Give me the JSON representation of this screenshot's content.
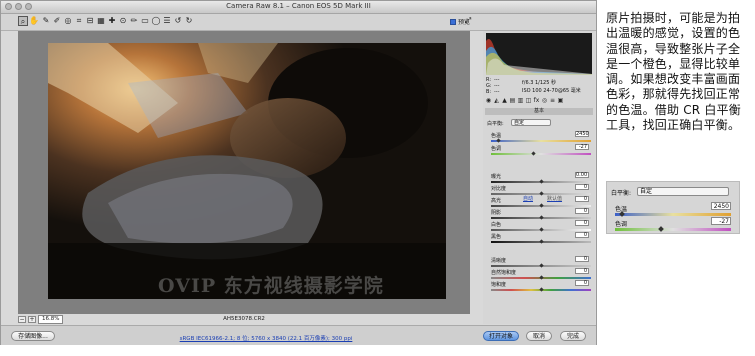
{
  "window": {
    "title": "Camera Raw 8.1 – Canon EOS 5D Mark III",
    "preview_label": "预览",
    "filename": "AH5E3078.CR2",
    "zoom": "16.8%",
    "watermark": "OVIP 东方视线摄影学院"
  },
  "histogram": {
    "aperture_shutter": "f/6.3  1/125 秒",
    "iso_lens": "ISO 100  24-70@65 毫米",
    "rgb_labels": [
      "R:",
      "G:",
      "B:"
    ],
    "rgb_values": [
      "---",
      "---",
      "---"
    ]
  },
  "panel": {
    "section": "基本",
    "white_balance_label": "白平衡:",
    "white_balance_value": "自定",
    "temperature_label": "色温",
    "temperature_value": "2450",
    "tint_label": "色调",
    "tint_value": "-27",
    "tab_auto": "自动",
    "tab_default": "默认值",
    "sliders": [
      {
        "label": "曝光",
        "value": "0.00"
      },
      {
        "label": "对比度",
        "value": "0"
      },
      {
        "label": "高光",
        "value": "0"
      },
      {
        "label": "阴影",
        "value": "0"
      },
      {
        "label": "白色",
        "value": "0"
      },
      {
        "label": "黑色",
        "value": "0"
      },
      {
        "label": "清晰度",
        "value": "0"
      },
      {
        "label": "自然饱和度",
        "value": "0"
      },
      {
        "label": "饱和度",
        "value": "0"
      }
    ]
  },
  "bottom": {
    "save_label": "存储图像...",
    "workflow_link": "sRGB IEC61966-2.1; 8 位; 5760 x 3840 (22.1 百万像素); 300 ppi",
    "open_label": "打开对象",
    "cancel_label": "取消",
    "done_label": "完成"
  },
  "article": {
    "text": "原片拍摄时，可能是为拍出温暖的感觉，设置的色温很高，导致整张片子全是一个橙色，显得比较单调。如果想改变丰富画面色彩，那就得先找回正常的色温。借助 CR 白平衡工具，找回正确白平衡。"
  },
  "inset": {
    "white_balance_label": "白平衡:",
    "white_balance_value": "自定",
    "temperature_label": "色温",
    "temperature_value": "2450",
    "tint_label": "色调",
    "tint_value": "-27"
  },
  "colors": {
    "primary_button": "#5f95df",
    "link": "#1b3fb3",
    "temperature_track": "#3a5fc8",
    "tint_track": "#6fbf3a"
  }
}
